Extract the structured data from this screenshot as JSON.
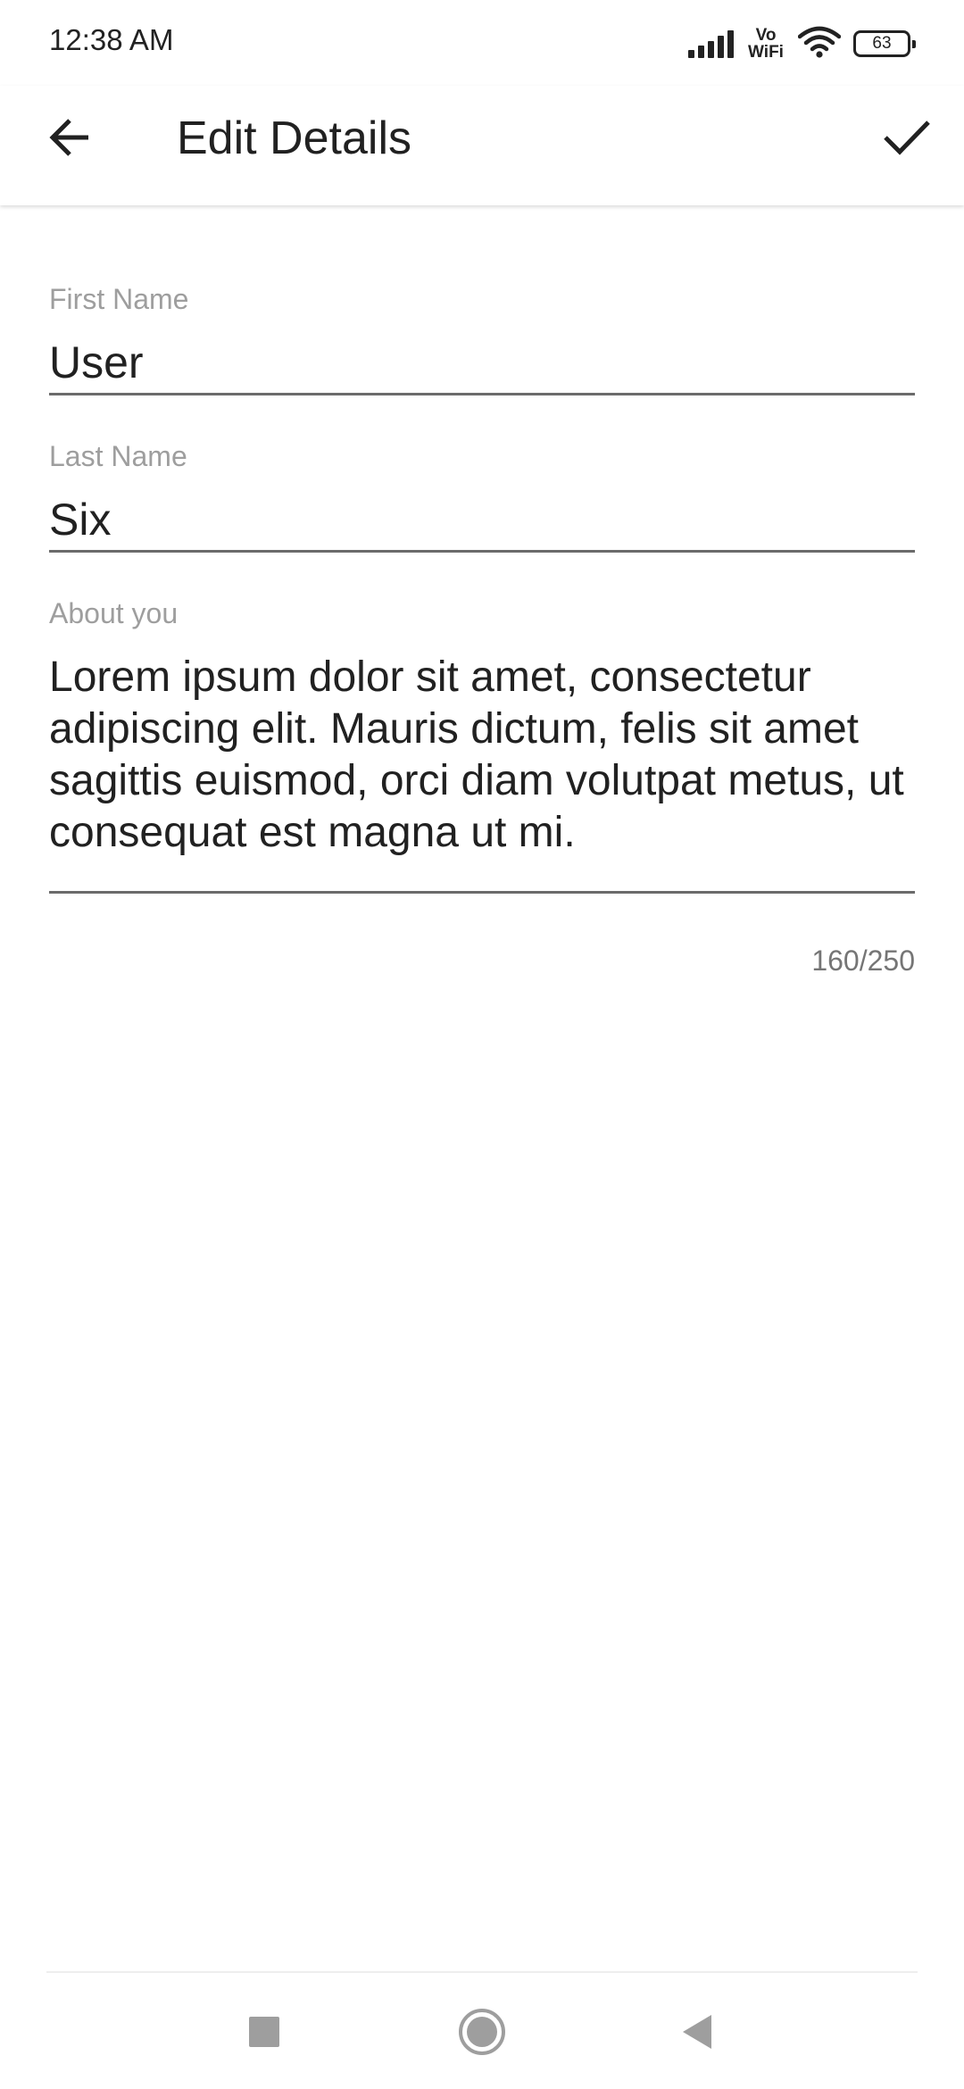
{
  "status_bar": {
    "time": "12:38 AM",
    "network_label": "Vo\nWiFi",
    "battery_level": "63"
  },
  "app_bar": {
    "title": "Edit Details",
    "back_icon": "arrow-back-icon",
    "confirm_icon": "check-icon"
  },
  "form": {
    "first_name": {
      "label": "First Name",
      "value": "User"
    },
    "last_name": {
      "label": "Last Name",
      "value": "Six"
    },
    "about": {
      "label": "About you",
      "value": "Lorem ipsum dolor sit amet, consectetur adipiscing elit. Mauris dictum, felis sit amet sagittis euismod, orci diam volutpat metus, ut consequat est magna ut mi.",
      "counter": "160/250"
    }
  },
  "nav_bar": {
    "recents_icon": "square-icon",
    "home_icon": "circle-icon",
    "back_icon": "triangle-back-icon"
  },
  "colors": {
    "text_primary": "#212121",
    "label": "#9e9e9e",
    "underline": "#6b6b6b",
    "nav_icon": "#9e9e9e"
  }
}
